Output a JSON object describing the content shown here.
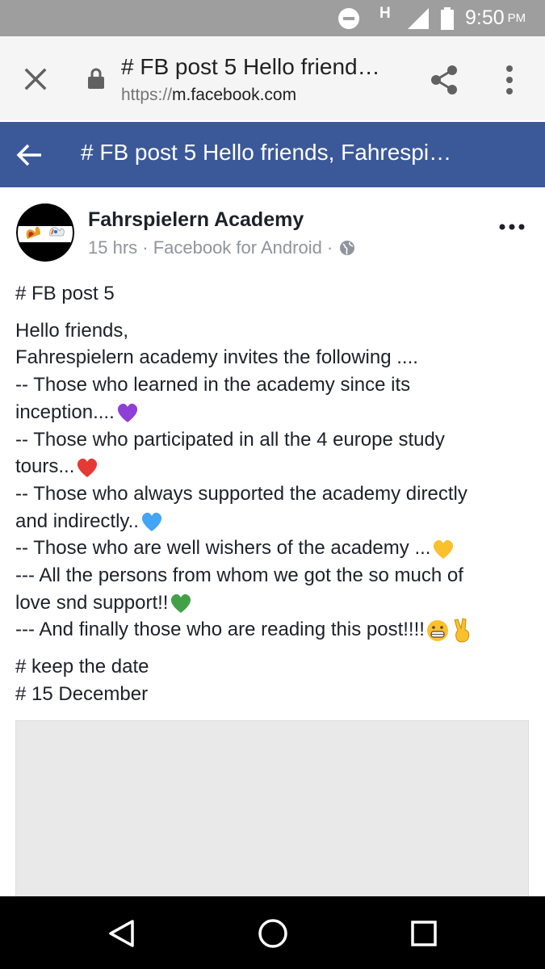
{
  "status_bar": {
    "network_letter": "H",
    "time": "9:50",
    "ampm": "PM"
  },
  "browser": {
    "page_title": "# FB post 5 Hello friend…",
    "url_scheme": "https://",
    "url_host": "m.facebook.com"
  },
  "fb_header": {
    "title": "# FB post 5 Hello friends, Fahrespi…"
  },
  "post": {
    "author": "Fahrspielern Academy",
    "meta": "15 hrs · Facebook for Android ·",
    "lines": {
      "tag": "# FB post 5",
      "l1": "Hello friends,",
      "l2": "Fahrespielern academy invites the following ....",
      "l3a": "-- Those who learned in the academy since its",
      "l3b": "inception....",
      "l4a": "-- Those who participated in all the 4 europe study",
      "l4b": "tours...",
      "l5a": "-- Those who always supported the academy directly",
      "l5b": "and indirectly..",
      "l6": "-- Those who are well wishers of the academy ...",
      "l7a": "--- All the persons from whom we got the so much of",
      "l7b": "love snd support!!",
      "l8": "--- And finally those who are reading this post!!!!",
      "h1": "# keep the date",
      "h2": "# 15 December"
    }
  },
  "icons": {
    "close": "close-icon",
    "lock": "lock-icon",
    "share": "share-icon",
    "menu": "more-vert-icon",
    "back": "back-arrow-icon",
    "globe": "globe-icon",
    "post_menu": "more-horiz-icon"
  },
  "colors": {
    "fb_blue": "#3b5998",
    "status_bar": "#9e9e9e",
    "toolbar": "#f5f5f5",
    "meta_text": "#90949c"
  }
}
